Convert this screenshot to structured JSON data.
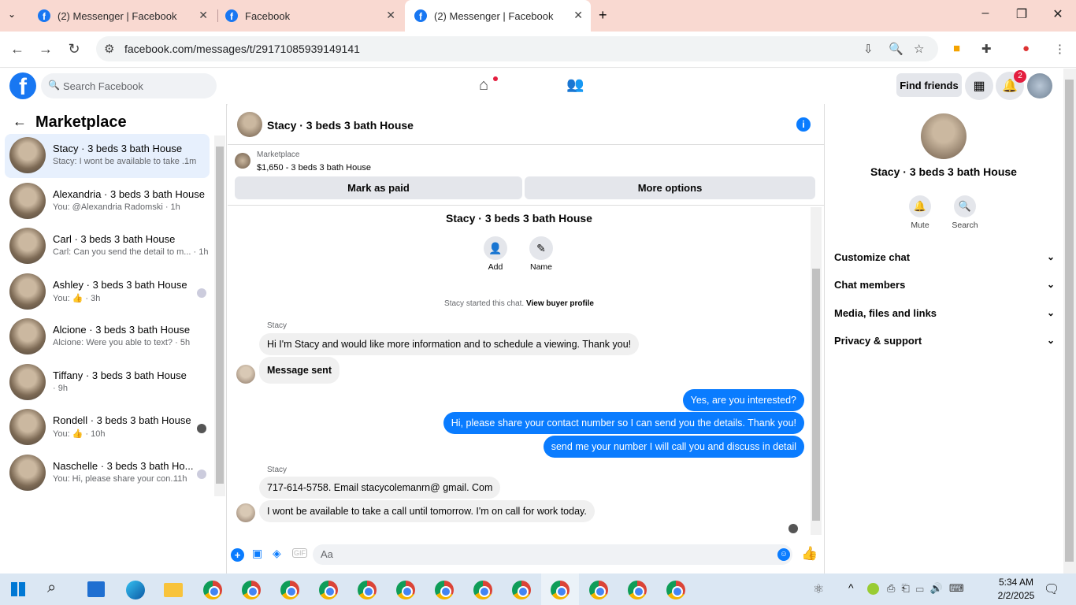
{
  "browser": {
    "tabs": [
      {
        "label": "(2) Messenger | Facebook"
      },
      {
        "label": "Facebook"
      },
      {
        "label": "(2) Messenger | Facebook"
      }
    ],
    "url": "facebook.com/messages/t/29171085939149141"
  },
  "fb_header": {
    "search_placeholder": "Search Facebook",
    "find_friends_label": "Find friends",
    "notification_count": "2"
  },
  "left_panel": {
    "title": "Marketplace",
    "conversations": [
      {
        "name": "Stacy · 3 beds 3 bath House",
        "snippet": "Stacy: I wont be available to take ...",
        "time": "1m"
      },
      {
        "name": "Alexandria · 3 beds 3 bath House",
        "snippet": "You: @Alexandria Radomski · 1h",
        "time": ""
      },
      {
        "name": "Carl · 3 beds 3 bath House",
        "snippet": "Carl: Can you send the detail to m... · 1h",
        "time": ""
      },
      {
        "name": "Ashley · 3 beds 3 bath House",
        "snippet": "You: 👍 · 3h",
        "time": ""
      },
      {
        "name": "Alcione · 3 beds 3 bath House",
        "snippet": "Alcione: Were you able to text? · 5h",
        "time": ""
      },
      {
        "name": "Tiffany · 3 beds 3 bath House",
        "snippet": "· 9h",
        "time": ""
      },
      {
        "name": "Rondell · 3 beds 3 bath House",
        "snippet": "You: 👍 · 10h",
        "time": ""
      },
      {
        "name": "Naschelle · 3 beds 3 bath Ho...",
        "snippet": "You: Hi, please share your con...",
        "time": "11h"
      }
    ]
  },
  "chat": {
    "title": "Stacy · 3 beds 3 bath House",
    "marketplace_label": "Marketplace",
    "listing": "$1,650 - 3 beds 3 bath House",
    "mark_paid_label": "Mark as paid",
    "more_options_label": "More options",
    "thread_title": "Stacy · 3 beds 3 bath House",
    "add_label": "Add",
    "name_label": "Name",
    "started_text": "Stacy started this chat.",
    "view_profile_label": "View buyer profile",
    "sender1": "Stacy",
    "msg1": "Hi I'm Stacy and would like more information and to schedule a viewing. Thank you!",
    "msg2": "Message sent",
    "out1": "Yes, are you interested?",
    "out2": "Hi, please share your contact number so I can send you the details. Thank you!",
    "out3": "send me your number I will call you and discuss in detail",
    "sender2": "Stacy",
    "msg3": "717-614-5758. Email stacycolemanrn@ gmail. Com",
    "msg4": "I wont be available to take a call until tomorrow. I'm on call for work today.",
    "composer_placeholder": "Aa"
  },
  "right_panel": {
    "title": "Stacy · 3 beds 3 bath House",
    "mute_label": "Mute",
    "search_label": "Search",
    "sections": [
      "Customize chat",
      "Chat members",
      "Media, files and links",
      "Privacy & support"
    ]
  },
  "taskbar": {
    "time": "5:34 AM",
    "date": "2/2/2025"
  },
  "colors": {
    "accent": "#0a7cff",
    "fb_blue": "#1877f2",
    "tab_strip": "#f9d9d1"
  }
}
